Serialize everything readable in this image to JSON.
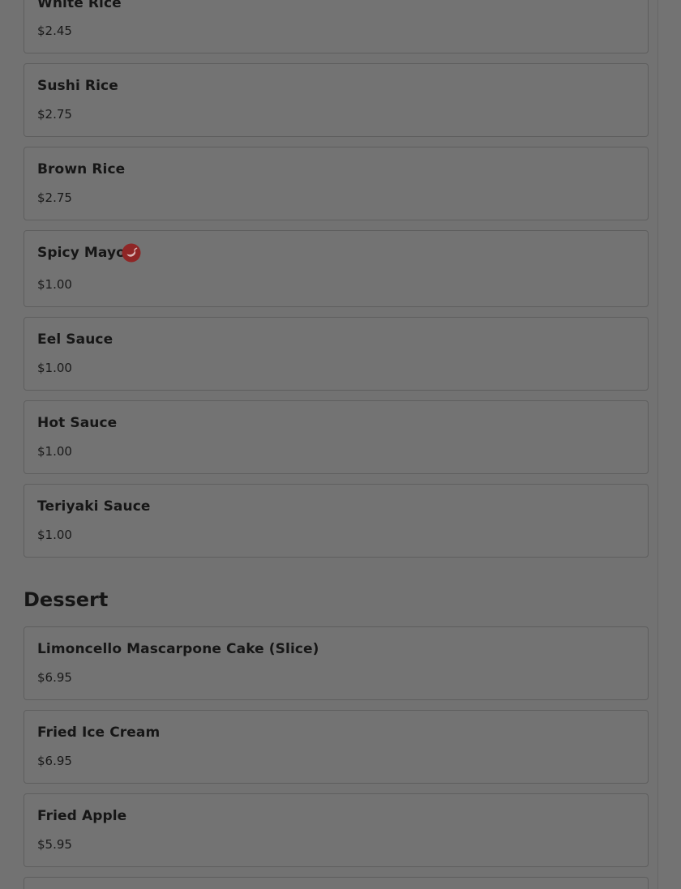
{
  "menu": {
    "items": [
      {
        "name": "White Rice",
        "price": "$2.45"
      },
      {
        "name": "Sushi Rice",
        "price": "$2.75"
      },
      {
        "name": "Brown Rice",
        "price": "$2.75"
      },
      {
        "name": "Spicy Mayo",
        "price": "$1.00",
        "icon": "chili-pepper-icon"
      },
      {
        "name": "Eel Sauce",
        "price": "$1.00"
      },
      {
        "name": "Hot Sauce",
        "price": "$1.00"
      },
      {
        "name": "Teriyaki Sauce",
        "price": "$1.00"
      }
    ],
    "dessert": {
      "title": "Dessert",
      "items": [
        {
          "name": "Limoncello Mascarpone Cake (Slice)",
          "price": "$6.95"
        },
        {
          "name": "Fried Ice Cream",
          "price": "$6.95"
        },
        {
          "name": "Fried Apple",
          "price": "$5.95"
        }
      ]
    }
  },
  "colors": {
    "overlay": "#737373",
    "spicy_icon": "#8f2626"
  }
}
